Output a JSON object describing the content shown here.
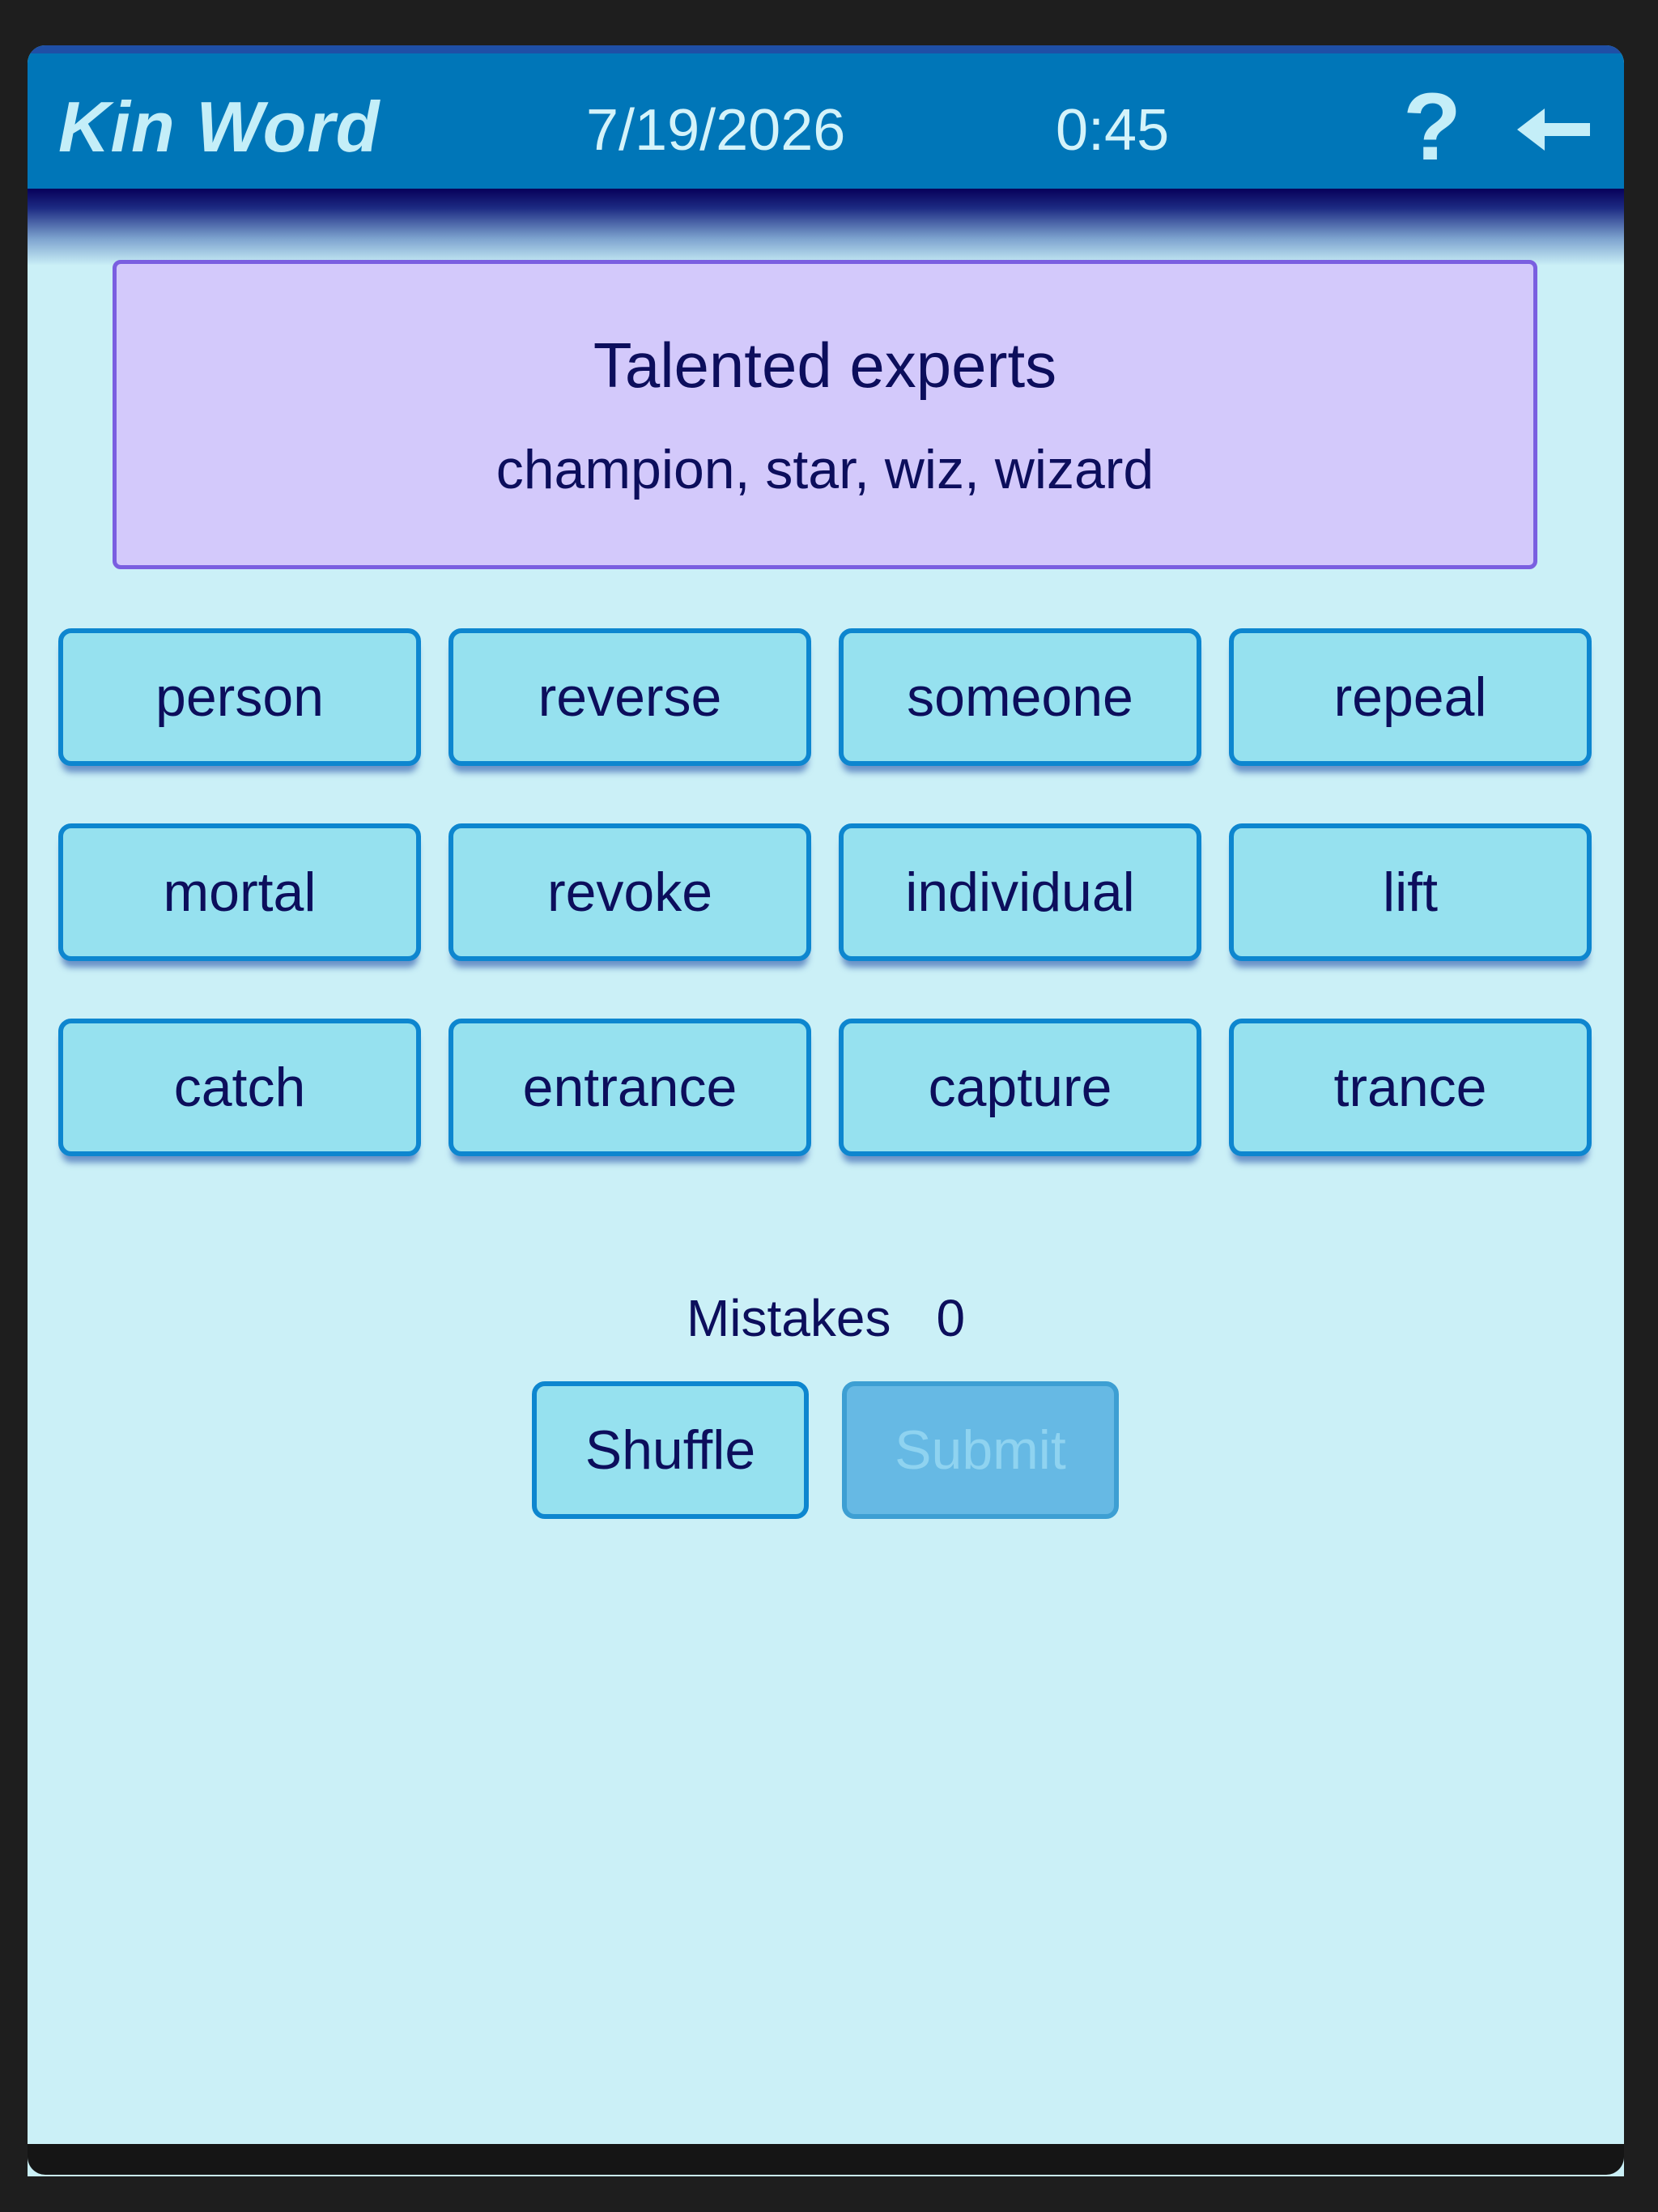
{
  "header": {
    "title": "Kin Word",
    "date": "7/19/2026",
    "timer": "0:45",
    "help_icon": "?",
    "back_icon": "arrow-left-icon"
  },
  "solved": {
    "title": "Talented experts",
    "words": "champion, star, wiz, wizard"
  },
  "tiles": [
    "person",
    "reverse",
    "someone",
    "repeal",
    "mortal",
    "revoke",
    "individual",
    "lift",
    "catch",
    "entrance",
    "capture",
    "trance"
  ],
  "status": {
    "mistakes_label": "Mistakes",
    "mistakes_value": "0"
  },
  "actions": {
    "shuffle_label": "Shuffle",
    "submit_label": "Submit"
  },
  "colors": {
    "header": "#0076b8",
    "background": "#cbf0f7",
    "solved_group": "#d3c9fb",
    "tile": "#96e1ef",
    "text": "#0c0e5c"
  }
}
